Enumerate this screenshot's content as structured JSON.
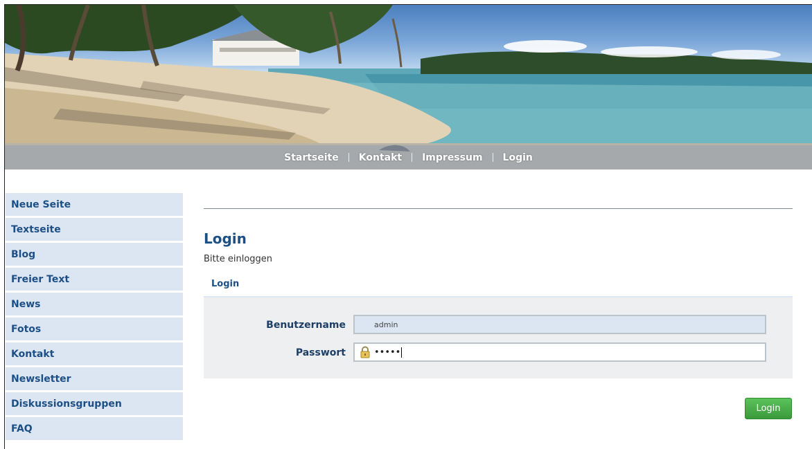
{
  "nav": {
    "items": [
      {
        "label": "Startseite"
      },
      {
        "label": "Kontakt"
      },
      {
        "label": "Impressum"
      },
      {
        "label": "Login"
      }
    ]
  },
  "sidebar": {
    "items": [
      {
        "label": "Neue Seite"
      },
      {
        "label": "Textseite"
      },
      {
        "label": "Blog"
      },
      {
        "label": "Freier Text"
      },
      {
        "label": "News"
      },
      {
        "label": "Fotos"
      },
      {
        "label": "Kontakt"
      },
      {
        "label": "Newsletter"
      },
      {
        "label": "Diskussionsgruppen"
      },
      {
        "label": "FAQ"
      }
    ]
  },
  "main": {
    "title": "Login",
    "intro": "Bitte einloggen",
    "form": {
      "section_title": "Login",
      "username_label": "Benutzername",
      "username_value": "admin",
      "password_label": "Passwort",
      "password_masked": "•••••",
      "submit_label": "Login"
    }
  },
  "icons": {
    "banner": "beach-banner-image",
    "password": "lock-icon"
  },
  "colors": {
    "link_blue": "#1d4f87",
    "sidebar_bg": "#dbe6f2",
    "button_green": "#3a9a3a"
  }
}
